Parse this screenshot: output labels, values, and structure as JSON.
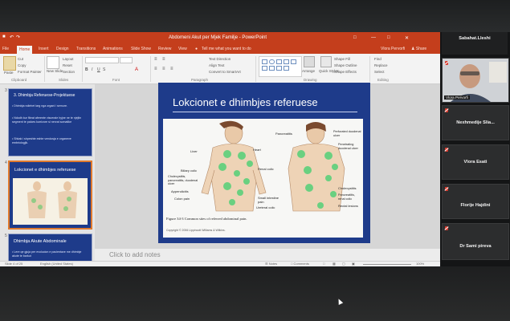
{
  "window": {
    "title": "Abdomeni Akut per Mjek Familje - PowerPoint",
    "user": "Vlora Pervorfi",
    "share": "Share"
  },
  "ribbon_tabs": [
    "File",
    "Home",
    "Insert",
    "Design",
    "Transitions",
    "Animations",
    "Slide Show",
    "Review",
    "View"
  ],
  "tell_me": "Tell me what you want to do",
  "ribbon": {
    "groups": [
      "Clipboard",
      "Slides",
      "Font",
      "Paragraph",
      "Drawing",
      "Editing"
    ],
    "paste": "Paste",
    "cut": "Cut",
    "copy": "Copy",
    "format_painter": "Format Painter",
    "new_slide": "New Slide",
    "layout": "Layout",
    "reset": "Reset",
    "section": "Section",
    "text_direction": "Text Direction",
    "align_text": "Align Text",
    "convert_smartart": "Convert to SmartArt",
    "arrange": "Arrange",
    "quick_styles": "Quick Styles",
    "shape_fill": "Shape Fill",
    "shape_outline": "Shape Outline",
    "shape_effects": "Shape Effects",
    "find": "Find",
    "replace": "Replace",
    "select": "Select"
  },
  "thumbnails": [
    {
      "num": "3",
      "title": "3. Dhimbja Referuese-Projektuese",
      "bullets": [
        "Dhimbja ndiehet larg nga organi i semure.",
        "Ndodh kur fibrat aferente viscerale hyjne ne te njejtin segment te palces kurrizore si nervat somatike",
        "Shkak i shpeshte eshte vendosja e organeve embriologjik."
      ]
    },
    {
      "num": "4",
      "title": "Lokcionet e dhimbjes referuese"
    },
    {
      "num": "5",
      "title": "Dhimbja Akute Abdominale",
      "bullets": [
        "Lere qe gjuja per evolucion e pacientave me dhimbje akute te barkut"
      ]
    }
  ],
  "slide": {
    "title": "Lokcionet e dhimbjes referuese",
    "figure": {
      "labels_left": [
        "Liver",
        "Heart",
        "Biliary colic",
        "Renal colic",
        "Cholecystitis, pancreatitis, duodenal ulcer",
        "Appendicitis",
        "Colon pain",
        "Small intestine pain",
        "Ureteral colic"
      ],
      "labels_right": [
        "Pancreatitis",
        "Perforated duodenal ulcer",
        "Penetrating duodenal ulcer",
        "Cholecystitis",
        "Pancreatitis, renal colic",
        "Rectal lesions"
      ],
      "caption": "Figure 34-3 Common sites of referred abdominal pain.",
      "copyright": "Copyright © 2006 Lippincott Williams & Wilkins."
    }
  },
  "notes_placeholder": "Click to add notes",
  "status": {
    "slide_of": "Slide 4 of 25",
    "language": "English (United States)",
    "notes": "Notes",
    "comments": "Comments",
    "zoom": "100%"
  },
  "participants": [
    {
      "name": "Sabahat.Lleshi",
      "type": "name"
    },
    {
      "name": "Vlora Pervorfi",
      "type": "video"
    },
    {
      "name": "Nexhmedije Slia...",
      "type": "name"
    },
    {
      "name": "Vlora Esati",
      "type": "name"
    },
    {
      "name": "Florije Hajdini",
      "type": "name"
    },
    {
      "name": "Dr Sami pireva",
      "type": "name"
    }
  ],
  "colors": {
    "ppt_accent": "#c43e1c",
    "slide_bg": "#1e3b8a",
    "tile_bg": "#2c2d2e",
    "muted_mic": "#d83b2f"
  }
}
